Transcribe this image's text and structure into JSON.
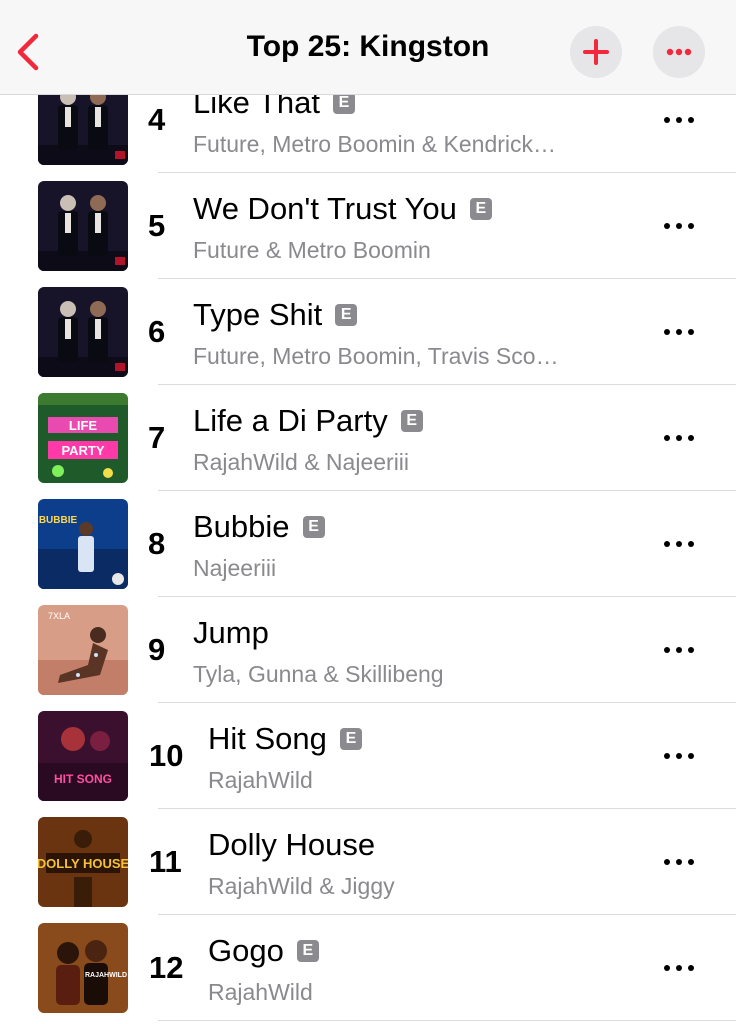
{
  "header": {
    "title": "Top 25: Kingston",
    "back_icon": "chevron-left-icon",
    "add_icon": "plus-icon",
    "more_icon": "ellipsis-icon",
    "accent_color": "#f2283c"
  },
  "tracks": [
    {
      "rank": "4",
      "title": "Like That",
      "explicit": true,
      "explicit_label": "E",
      "artist": "Future, Metro Boomin & Kendrick…",
      "art": "dark"
    },
    {
      "rank": "5",
      "title": "We Don't Trust You",
      "explicit": true,
      "explicit_label": "E",
      "artist": "Future & Metro Boomin",
      "art": "dark"
    },
    {
      "rank": "6",
      "title": "Type Shit",
      "explicit": true,
      "explicit_label": "E",
      "artist": "Future, Metro Boomin, Travis Sco…",
      "art": "dark"
    },
    {
      "rank": "7",
      "title": "Life a Di Party",
      "explicit": true,
      "explicit_label": "E",
      "artist": "RajahWild & Najeeriii",
      "art": "party",
      "art_text": "LIFE A DI PARTY"
    },
    {
      "rank": "8",
      "title": "Bubbie",
      "explicit": true,
      "explicit_label": "E",
      "artist": "Najeeriii",
      "art": "blue",
      "art_text": "BUBBIE"
    },
    {
      "rank": "9",
      "title": "Jump",
      "explicit": false,
      "explicit_label": "",
      "artist": "Tyla, Gunna & Skillibeng",
      "art": "tyla",
      "art_text": "TYLA"
    },
    {
      "rank": "10",
      "title": "Hit Song",
      "explicit": true,
      "explicit_label": "E",
      "artist": "RajahWild",
      "art": "hitsong",
      "art_text": "HIT SONG"
    },
    {
      "rank": "11",
      "title": "Dolly House",
      "explicit": false,
      "explicit_label": "",
      "artist": "RajahWild & Jiggy",
      "art": "dolly",
      "art_text": "DOLLY HOUSE"
    },
    {
      "rank": "12",
      "title": "Gogo",
      "explicit": true,
      "explicit_label": "E",
      "artist": "RajahWild",
      "art": "gogo",
      "art_text": "RAJAHWILD"
    }
  ]
}
